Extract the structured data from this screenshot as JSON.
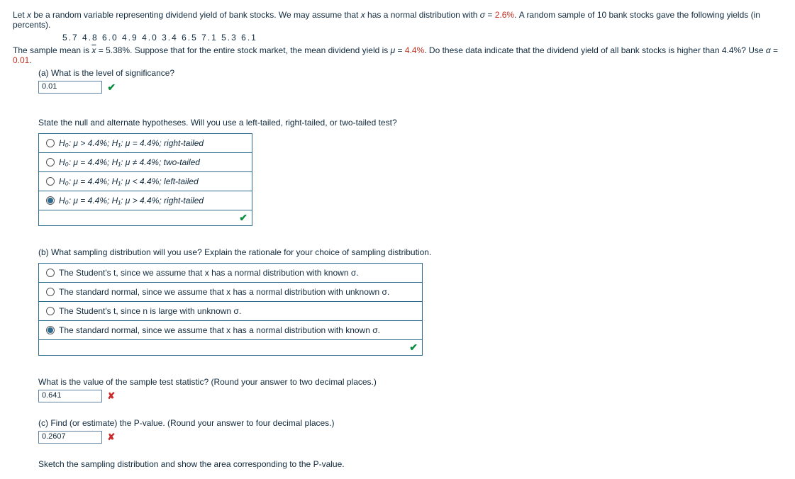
{
  "intro": {
    "part1": "Let ",
    "var_x": "x",
    "part2": " be a random variable representing dividend yield of bank stocks. We may assume that ",
    "part3": " has a normal distribution with ",
    "sigma_sym": "σ",
    "sigma_eq": " = ",
    "sigma_val": "2.6%",
    "part4": ". A random sample of 10 bank stocks gave the following yields (in percents)."
  },
  "data_row": "5.7   4.8   6.0   4.9   4.0   3.4   6.5   7.1   5.3   6.1",
  "mean_line": {
    "p1": "The sample mean is ",
    "xbar": "x",
    "p2": " = 5.38%. Suppose that for the entire stock market, the mean dividend yield is ",
    "mu_sym": "μ",
    "eq": " = ",
    "mu_val": "4.4%",
    "p3": ". Do these data indicate that the dividend yield of all bank stocks is higher than 4.4%? Use ",
    "alpha_sym": "α",
    "alpha_eq": " = ",
    "alpha_val": "0.01",
    "p4": "."
  },
  "partA": {
    "q": "(a) What is the level of significance?",
    "ans": "0.01"
  },
  "hyp": {
    "prompt": "State the null and alternate hypotheses. Will you use a left-tailed, right-tailed, or two-tailed test?",
    "opts": [
      "H₀: μ > 4.4%; H₁: μ = 4.4%; right-tailed",
      "H₀: μ = 4.4%; H₁: μ ≠ 4.4%; two-tailed",
      "H₀: μ = 4.4%; H₁: μ < 4.4%; left-tailed",
      "H₀: μ = 4.4%; H₁: μ > 4.4%; right-tailed"
    ],
    "selected": 3
  },
  "partB": {
    "q": "(b) What sampling distribution will you use? Explain the rationale for your choice of sampling distribution.",
    "opts": [
      "The Student's t, since we assume that x has a normal distribution with known σ.",
      "The standard normal, since we assume that x has a normal distribution with unknown σ.",
      "The Student's t, since n is large with unknown σ.",
      "The standard normal, since we assume that x has a normal distribution with known σ."
    ],
    "selected": 3
  },
  "test_stat": {
    "q": "What is the value of the sample test statistic? (Round your answer to two decimal places.)",
    "ans": "0.641"
  },
  "partC": {
    "q": "(c) Find (or estimate) the P-value. (Round your answer to four decimal places.)",
    "ans": "0.2607"
  },
  "sketch": "Sketch the sampling distribution and show the area corresponding to the P-value."
}
